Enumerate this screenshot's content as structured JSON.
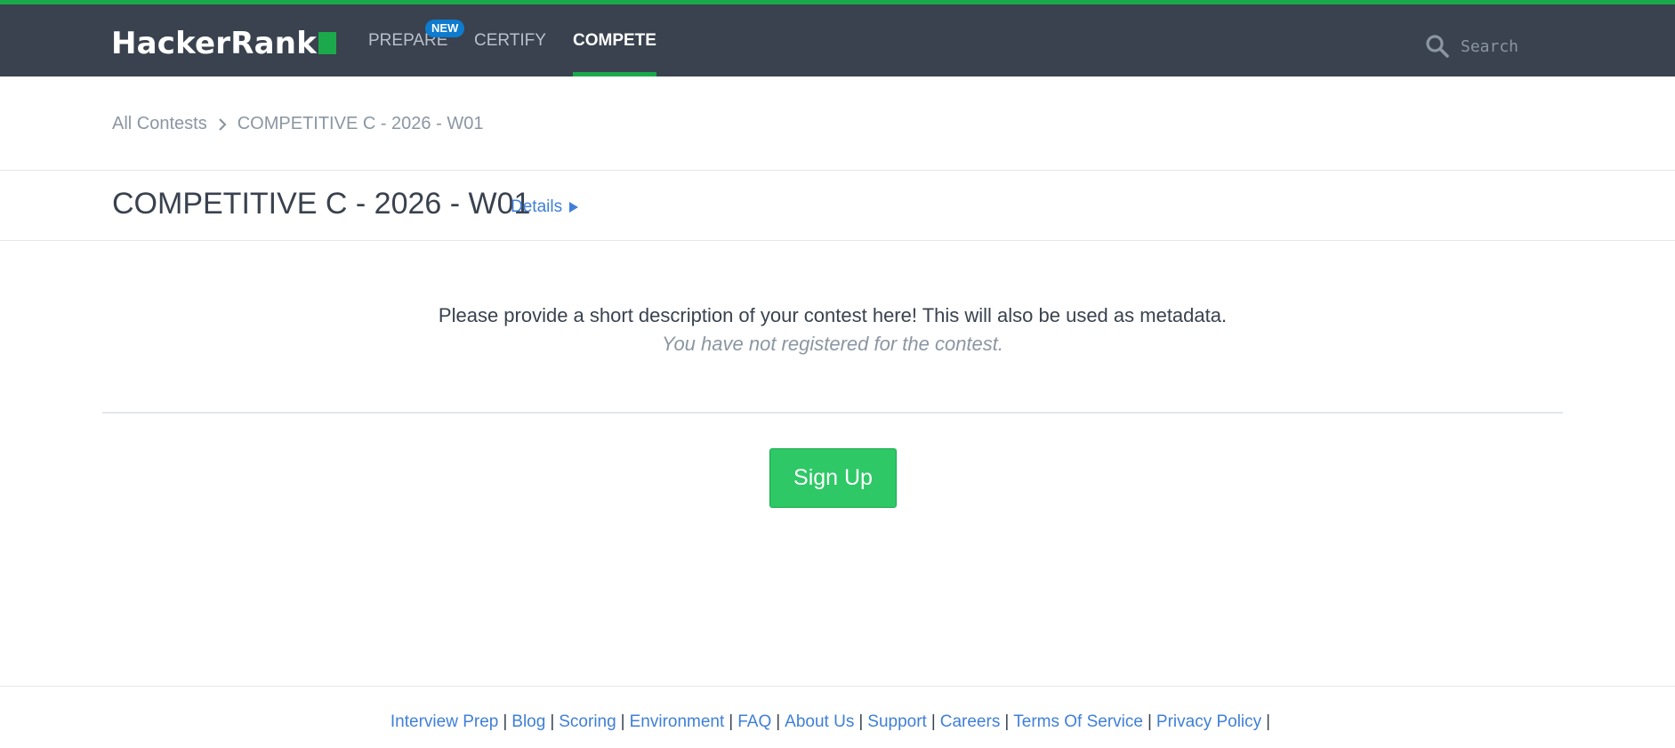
{
  "header": {
    "logo_text": "HackerRank",
    "nav": {
      "prepare": "PREPARE",
      "prepare_badge": "NEW",
      "certify": "CERTIFY",
      "compete": "COMPETE"
    },
    "search": {
      "placeholder": "Search",
      "value": ""
    },
    "accent_color": "#1ba94c",
    "background_color": "#39424e"
  },
  "breadcrumb": {
    "parent": "All Contests",
    "current": "COMPETITIVE C - 2026 - W01"
  },
  "contest": {
    "title": "COMPETITIVE C - 2026 - W01",
    "details_link": "Details",
    "description": "Please provide a short description of your contest here! This will also be used as metadata.",
    "registration_status": "You have not registered for the contest.",
    "signup_label": "Sign Up",
    "signup_color": "#2ec866"
  },
  "footer": {
    "links": [
      "Interview Prep",
      "Blog",
      "Scoring",
      "Environment",
      "FAQ",
      "About Us",
      "Support",
      "Careers",
      "Terms Of Service",
      "Privacy Policy"
    ],
    "link_color": "#3f7fd8"
  },
  "icons": {
    "search": "search-icon",
    "breadcrumb_separator": "chevron-right-icon",
    "details": "play-triangle-icon"
  }
}
